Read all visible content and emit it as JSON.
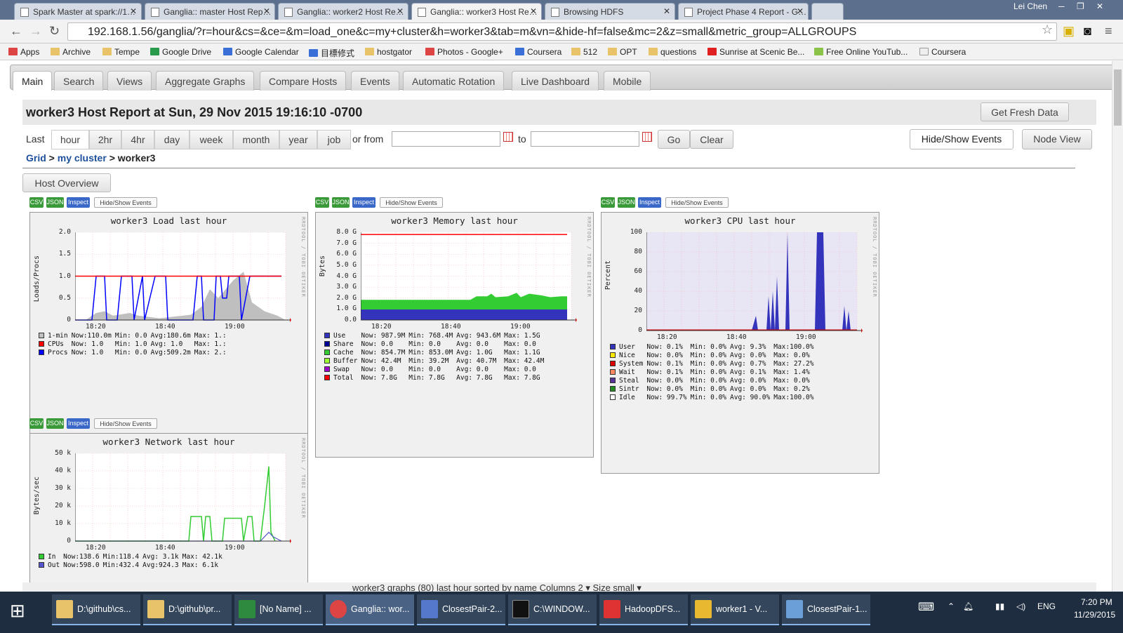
{
  "browser": {
    "tabs": [
      "Spark Master at spark://1…",
      "Ganglia:: master Host Rep…",
      "Ganglia:: worker2 Host Re…",
      "Ganglia:: worker3 Host Re…",
      "Browsing HDFS",
      "Project Phase 4 Report - G…"
    ],
    "user": "Lei Chen",
    "url": "192.168.1.56/ganglia/?r=hour&cs=&ce=&m=load_one&c=my+cluster&h=worker3&tab=m&vn=&hide-hf=false&mc=2&z=small&metric_group=ALLGROUPS",
    "bookmarks": [
      "Apps",
      "Archive",
      "Tempe",
      "Google Drive",
      "Google Calendar",
      "目標修式",
      "hostgator",
      "Photos - Google+",
      "Coursera",
      "512",
      "OPT",
      "questions",
      "Sunrise at Scenic Be...",
      "Free Online YouTub...",
      "Coursera"
    ]
  },
  "ganglia": {
    "tabs": [
      "Main",
      "Search",
      "Views",
      "Aggregate Graphs",
      "Compare Hosts",
      "Events",
      "Automatic Rotation",
      "Live Dashboard",
      "Mobile"
    ],
    "title": "worker3 Host Report at Sun, 29 Nov 2015 19:16:10 -0700",
    "fresh": "Get Fresh Data",
    "last": "Last",
    "ranges": [
      "hour",
      "2hr",
      "4hr",
      "day",
      "week",
      "month",
      "year",
      "job"
    ],
    "or_from": "or from",
    "to": "to",
    "go": "Go",
    "clear": "Clear",
    "hide_show": "Hide/Show Events",
    "node_view": "Node View",
    "crumb_grid": "Grid",
    "crumb_sep": ">",
    "crumb_cluster": "my cluster",
    "crumb_host": "worker3",
    "host_overview": "Host Overview",
    "mini": {
      "csv": "CSV",
      "json": "JSON",
      "inspect": "Inspect",
      "hse": "Hide/Show Events"
    },
    "watermark": "RRDTOOL / TOBI OETIKER",
    "bottom": "worker3 graphs (80) last hour sorted by name  Columns  2  ▾  Size  small  ▾"
  },
  "graphs": {
    "load": {
      "title": "worker3 Load last hour",
      "ylabel": "Loads/Procs",
      "yticks": [
        "2.0",
        "1.5",
        "1.0",
        "0.5",
        "0"
      ],
      "xticks": [
        "18:20",
        "18:40",
        "19:00"
      ],
      "legend": [
        {
          "name": "1-min",
          "color": "#bfbfbf",
          "now": "Now:110.0m",
          "min": "Min:   0.0",
          "avg": "Avg:180.6m",
          "max": "Max:   1.:"
        },
        {
          "name": "CPUs",
          "color": "#ff0000",
          "now": "Now:   1.0",
          "min": "Min:   1.0",
          "avg": "Avg:   1.0",
          "max": "Max:   1.:"
        },
        {
          "name": "Procs",
          "color": "#0000ff",
          "now": "Now:   1.0",
          "min": "Min:   0.0",
          "avg": "Avg:509.2m",
          "max": "Max:   2.:"
        }
      ]
    },
    "memory": {
      "title": "worker3 Memory last hour",
      "ylabel": "Bytes",
      "yticks": [
        "8.0 G",
        "7.0 G",
        "6.0 G",
        "5.0 G",
        "4.0 G",
        "3.0 G",
        "2.0 G",
        "1.0 G",
        "0.0"
      ],
      "xticks": [
        "18:20",
        "18:40",
        "19:00"
      ],
      "legend": [
        {
          "name": "Use",
          "color": "#3333bb",
          "now": "Now: 987.9M",
          "min": "Min: 768.4M",
          "avg": "Avg: 943.6M",
          "max": "Max:    1.5G"
        },
        {
          "name": "Share",
          "color": "#000099",
          "now": "Now:    0.0",
          "min": "Min:    0.0",
          "avg": "Avg:    0.0",
          "max": "Max:    0.0"
        },
        {
          "name": "Cache",
          "color": "#33cc33",
          "now": "Now: 854.7M",
          "min": "Min: 853.0M",
          "avg": "Avg:    1.0G",
          "max": "Max:    1.1G"
        },
        {
          "name": "Buffer",
          "color": "#99ff33",
          "now": "Now:  42.4M",
          "min": "Min:  39.2M",
          "avg": "Avg:  40.7M",
          "max": "Max:  42.4M"
        },
        {
          "name": "Swap",
          "color": "#9900cc",
          "now": "Now:    0.0",
          "min": "Min:    0.0",
          "avg": "Avg:    0.0",
          "max": "Max:    0.0"
        },
        {
          "name": "Total",
          "color": "#ff0000",
          "now": "Now:    7.8G",
          "min": "Min:    7.8G",
          "avg": "Avg:    7.8G",
          "max": "Max:    7.8G"
        }
      ]
    },
    "cpu": {
      "title": "worker3 CPU last hour",
      "ylabel": "Percent",
      "yticks": [
        "100",
        "80",
        "60",
        "40",
        "20",
        "0"
      ],
      "xticks": [
        "18:20",
        "18:40",
        "19:00"
      ],
      "legend": [
        {
          "name": "User",
          "color": "#3333bb",
          "now": "Now:  0.1%",
          "min": "Min:  0.0%",
          "avg": "Avg:  9.3%",
          "max": "Max:100.0%"
        },
        {
          "name": "Nice",
          "color": "#ffea00",
          "now": "Now:  0.0%",
          "min": "Min:  0.0%",
          "avg": "Avg:  0.0%",
          "max": "Max:  0.0%"
        },
        {
          "name": "System",
          "color": "#dd0000",
          "now": "Now:  0.1%",
          "min": "Min:  0.0%",
          "avg": "Avg:  0.7%",
          "max": "Max: 27.2%"
        },
        {
          "name": "Wait",
          "color": "#ff8a60",
          "now": "Now:  0.1%",
          "min": "Min:  0.0%",
          "avg": "Avg:  0.1%",
          "max": "Max:  1.4%"
        },
        {
          "name": "Steal",
          "color": "#553399",
          "now": "Now:  0.0%",
          "min": "Min:  0.0%",
          "avg": "Avg:  0.0%",
          "max": "Max:  0.0%"
        },
        {
          "name": "Sintr",
          "color": "#228b22",
          "now": "Now:  0.0%",
          "min": "Min:  0.0%",
          "avg": "Avg:  0.0%",
          "max": "Max:  0.2%"
        },
        {
          "name": "Idle",
          "color": "#ffffff",
          "now": "Now: 99.7%",
          "min": "Min:  0.0%",
          "avg": "Avg: 90.0%",
          "max": "Max:100.0%"
        }
      ]
    },
    "network": {
      "title": "worker3 Network last hour",
      "ylabel": "Bytes/sec",
      "yticks": [
        "50 k",
        "40 k",
        "30 k",
        "20 k",
        "10 k",
        "0"
      ],
      "xticks": [
        "18:20",
        "18:40",
        "19:00"
      ],
      "legend": [
        {
          "name": "In",
          "color": "#33cc33",
          "now": "Now:138.6",
          "min": "Min:118.4",
          "avg": "Avg:  3.1k",
          "max": "Max: 42.1k"
        },
        {
          "name": "Out",
          "color": "#5555cc",
          "now": "Now:598.0",
          "min": "Min:432.4",
          "avg": "Avg:924.3",
          "max": "Max:  6.1k"
        }
      ]
    }
  },
  "taskbar": {
    "items": [
      "D:\\github\\cs...",
      "D:\\github\\pr...",
      "[No Name] ...",
      "Ganglia:: wor...",
      "ClosestPair-2...",
      "C:\\WINDOW...",
      "HadoopDFS...",
      "worker1 - V...",
      "ClosestPair-1..."
    ],
    "lang": "ENG",
    "time": "7:20 PM",
    "date": "11/29/2015"
  }
}
